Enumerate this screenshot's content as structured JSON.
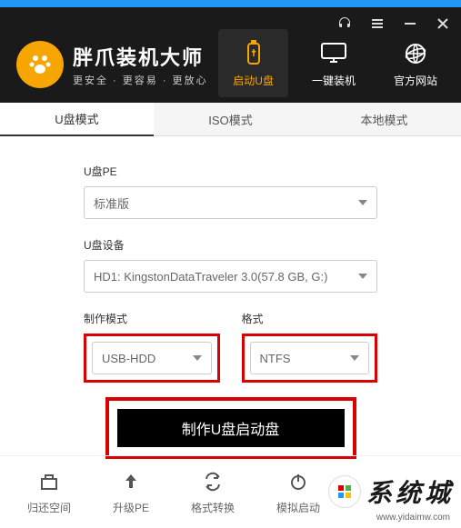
{
  "brand": {
    "title": "胖爪装机大师",
    "subtitle": "更安全 · 更容易 · 更放心"
  },
  "nav": {
    "usb": "启动U盘",
    "reinstall": "一键装机",
    "website": "官方网站"
  },
  "tabs": {
    "usb_mode": "U盘模式",
    "iso_mode": "ISO模式",
    "local_mode": "本地模式"
  },
  "form": {
    "pe_label": "U盘PE",
    "pe_value": "标准版",
    "device_label": "U盘设备",
    "device_value": "HD1: KingstonDataTraveler 3.0(57.8 GB, G:)",
    "mode_label": "制作模式",
    "mode_value": "USB-HDD",
    "format_label": "格式",
    "format_value": "NTFS",
    "main_button": "制作U盘启动盘"
  },
  "footer": {
    "restore": "归还空间",
    "upgrade": "升级PE",
    "convert": "格式转换",
    "simulate": "模拟启动"
  },
  "watermark": {
    "brand": "系统城",
    "url": "www.yidaimw.com"
  }
}
